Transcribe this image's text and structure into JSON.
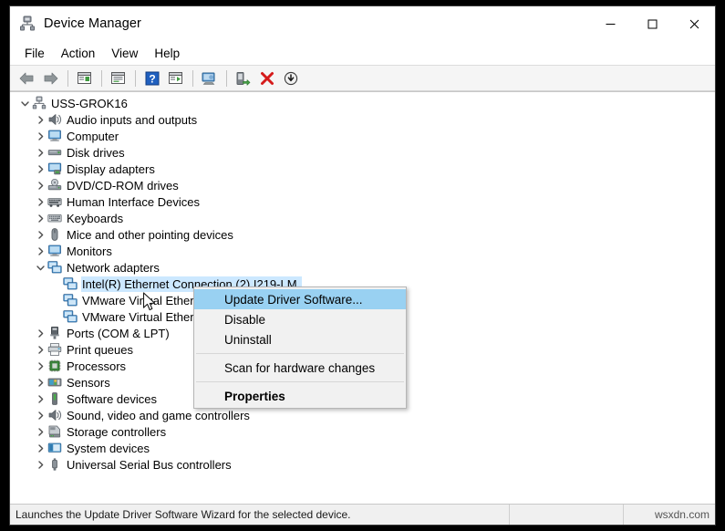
{
  "window": {
    "title": "Device Manager",
    "icon": "device-manager-icon",
    "controls": {
      "minimize": "—",
      "maximize": "☐",
      "close": "✕"
    }
  },
  "menubar": {
    "items": [
      {
        "label": "File"
      },
      {
        "label": "Action"
      },
      {
        "label": "View"
      },
      {
        "label": "Help"
      }
    ]
  },
  "toolbar": {
    "buttons": [
      {
        "name": "back-icon",
        "title": "Back"
      },
      {
        "name": "forward-icon",
        "title": "Forward"
      },
      {
        "name": "show-hide-console-tree-icon",
        "title": "Show/Hide Console Tree"
      },
      {
        "name": "properties-icon",
        "title": "Properties"
      },
      {
        "name": "help-icon",
        "title": "Help"
      },
      {
        "name": "scan-for-hardware-changes-icon",
        "title": "Scan for hardware changes"
      },
      {
        "name": "update-driver-software-icon",
        "title": "Update Driver Software"
      },
      {
        "name": "enable-device-icon",
        "title": "Enable device"
      },
      {
        "name": "uninstall-device-icon",
        "title": "Uninstall device"
      },
      {
        "name": "disable-device-icon",
        "title": "Disable device"
      }
    ]
  },
  "tree": {
    "root": {
      "label": "USS-GROK16",
      "icon": "computer-root-icon",
      "expanded": true
    },
    "nodes": [
      {
        "label": "Audio inputs and outputs",
        "icon": "speaker-icon",
        "level": 1,
        "expanded": false
      },
      {
        "label": "Computer",
        "icon": "monitor-icon",
        "level": 1,
        "expanded": false
      },
      {
        "label": "Disk drives",
        "icon": "disk-drive-icon",
        "level": 1,
        "expanded": false
      },
      {
        "label": "Display adapters",
        "icon": "display-adapter-icon",
        "level": 1,
        "expanded": false
      },
      {
        "label": "DVD/CD-ROM drives",
        "icon": "optical-drive-icon",
        "level": 1,
        "expanded": false
      },
      {
        "label": "Human Interface Devices",
        "icon": "hid-icon",
        "level": 1,
        "expanded": false
      },
      {
        "label": "Keyboards",
        "icon": "keyboard-icon",
        "level": 1,
        "expanded": false
      },
      {
        "label": "Mice and other pointing devices",
        "icon": "mouse-icon",
        "level": 1,
        "expanded": false
      },
      {
        "label": "Monitors",
        "icon": "monitor-icon",
        "level": 1,
        "expanded": false
      },
      {
        "label": "Network adapters",
        "icon": "network-adapter-icon",
        "level": 1,
        "expanded": true
      },
      {
        "label": "Intel(R) Ethernet Connection (2) I219-LM",
        "icon": "network-adapter-icon",
        "level": 2,
        "selected": true
      },
      {
        "label": "VMware Virtual Ethernet Adapter for VMnet1",
        "icon": "network-adapter-icon",
        "level": 2
      },
      {
        "label": "VMware Virtual Ethernet Adapter for VMnet8",
        "icon": "network-adapter-icon",
        "level": 2
      },
      {
        "label": "Ports (COM & LPT)",
        "icon": "port-icon",
        "level": 1,
        "expanded": false
      },
      {
        "label": "Print queues",
        "icon": "printer-icon",
        "level": 1,
        "expanded": false
      },
      {
        "label": "Processors",
        "icon": "processor-icon",
        "level": 1,
        "expanded": false
      },
      {
        "label": "Sensors",
        "icon": "sensor-icon",
        "level": 1,
        "expanded": false
      },
      {
        "label": "Software devices",
        "icon": "software-device-icon",
        "level": 1,
        "expanded": false
      },
      {
        "label": "Sound, video and game controllers",
        "icon": "speaker-icon",
        "level": 1,
        "expanded": false
      },
      {
        "label": "Storage controllers",
        "icon": "storage-controller-icon",
        "level": 1,
        "expanded": false
      },
      {
        "label": "System devices",
        "icon": "system-device-icon",
        "level": 1,
        "expanded": false
      },
      {
        "label": "Universal Serial Bus controllers",
        "icon": "usb-icon",
        "level": 1,
        "expanded": false
      }
    ]
  },
  "context_menu": {
    "items": [
      {
        "label": "Update Driver Software...",
        "highlight": true,
        "bold": false
      },
      {
        "label": "Disable",
        "highlight": false,
        "bold": false
      },
      {
        "label": "Uninstall",
        "highlight": false,
        "bold": false
      },
      {
        "separator": true
      },
      {
        "label": "Scan for hardware changes",
        "highlight": false,
        "bold": false
      },
      {
        "separator": true
      },
      {
        "label": "Properties",
        "highlight": false,
        "bold": true
      }
    ]
  },
  "statusbar": {
    "message": "Launches the Update Driver Software Wizard for the selected device.",
    "middle": "",
    "watermark": "wsxdn.com"
  },
  "colors": {
    "selection_blue": "#cce8ff",
    "menu_highlight": "#99d1f2",
    "toolbar_bg": "#f5f5f5",
    "statusbar_bg": "#f0f0f0",
    "close_red": "#e81123"
  }
}
